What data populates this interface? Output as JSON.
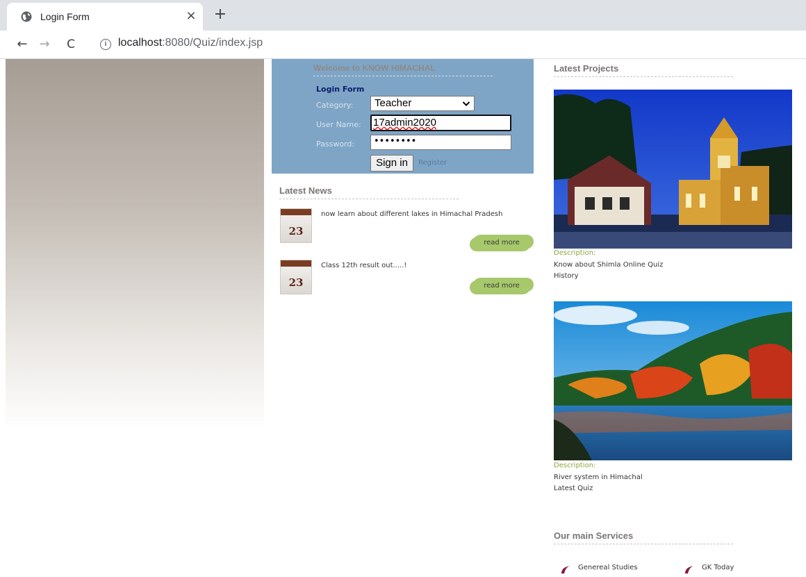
{
  "browser": {
    "tab_title": "Login Form",
    "close_glyph": "×",
    "newtab_glyph": "+",
    "url_host": "localhost",
    "url_path": ":8080/Quiz/index.jsp"
  },
  "login": {
    "welcome": "Welcome to KNOW HIMACHAL",
    "form_title": "Login Form",
    "category_label": "Category:",
    "category_value": "Teacher",
    "username_label": "User Name:",
    "username_value": "17admin2020",
    "password_label": "Password:",
    "password_mask": "••••••••",
    "signin_label": "Sign in",
    "register_label": "Register"
  },
  "news": {
    "title": "Latest News",
    "items": [
      {
        "day": "23",
        "text": "now learn about different lakes in Himachal Pradesh",
        "link": "read more"
      },
      {
        "day": "23",
        "text": "Class 12th result out.....!",
        "link": "read more"
      }
    ]
  },
  "projects": {
    "title": "Latest Projects",
    "items": [
      {
        "label": "Description:",
        "line1": "Know about Shimla Online Quiz",
        "line2": "History"
      },
      {
        "label": "Description:",
        "line1": "River system in Himachal",
        "line2": "Latest Quiz"
      }
    ]
  },
  "services": {
    "title": "Our main Services",
    "items": [
      "Genereal Studies",
      "GK Today"
    ]
  },
  "colors": {
    "login_panel": "#7ea5c6",
    "read_more_bg": "#a7c86b",
    "description_label": "#8aa43a",
    "service_icon": "#8a1a3c"
  }
}
